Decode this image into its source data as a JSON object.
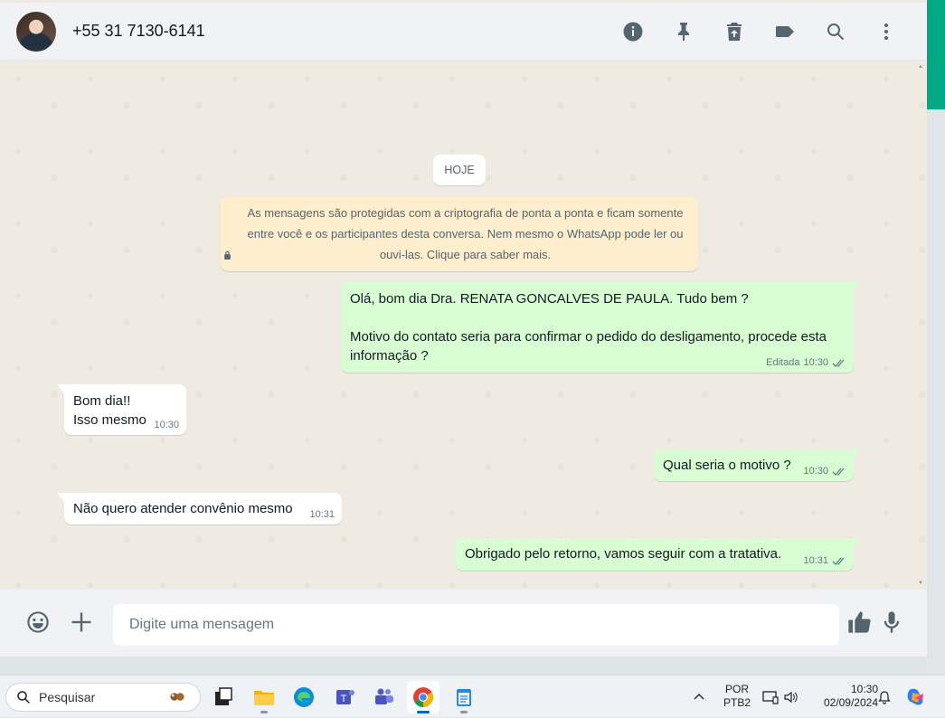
{
  "header": {
    "contact_name": "+55 31 7130-6141",
    "icons": [
      "info-icon",
      "pin-icon",
      "delete-icon",
      "label-icon",
      "search-icon",
      "menu-icon"
    ]
  },
  "chat": {
    "date_chip": "HOJE",
    "encryption_notice": "As mensagens são protegidas com a criptografia de ponta a ponta e ficam somente entre você e os participantes desta conversa. Nem mesmo o WhatsApp pode ler ou ouvi-las. Clique para saber mais.",
    "messages": [
      {
        "direction": "out",
        "text": "Olá, bom dia Dra. RENATA GONCALVES DE PAULA. Tudo bem ?\n\nMotivo do contato seria para confirmar o pedido do desligamento, procede esta informação ?",
        "edited": "Editada",
        "time": "10:30",
        "status": "read"
      },
      {
        "direction": "in",
        "text": "Bom dia!!\nIsso mesmo",
        "time": "10:30"
      },
      {
        "direction": "out",
        "text": "Qual seria o motivo ?",
        "time": "10:30",
        "status": "read"
      },
      {
        "direction": "in",
        "text": "Não quero atender convênio mesmo",
        "time": "10:31"
      },
      {
        "direction": "out",
        "text": "Obrigado pelo retorno, vamos seguir com a tratativa.",
        "time": "10:31",
        "status": "read"
      }
    ]
  },
  "composer": {
    "placeholder": "Digite uma mensagem"
  },
  "taskbar": {
    "search_placeholder": "Pesquisar",
    "language_top": "POR",
    "language_bottom": "PTB2",
    "time": "10:30",
    "date": "02/09/2024"
  },
  "colors": {
    "accent": "#00a884",
    "outgoing_bubble": "#d9fdd3",
    "incoming_bubble": "#ffffff",
    "encryption_bg": "#ffeecd",
    "read_ticks": "#667781"
  }
}
